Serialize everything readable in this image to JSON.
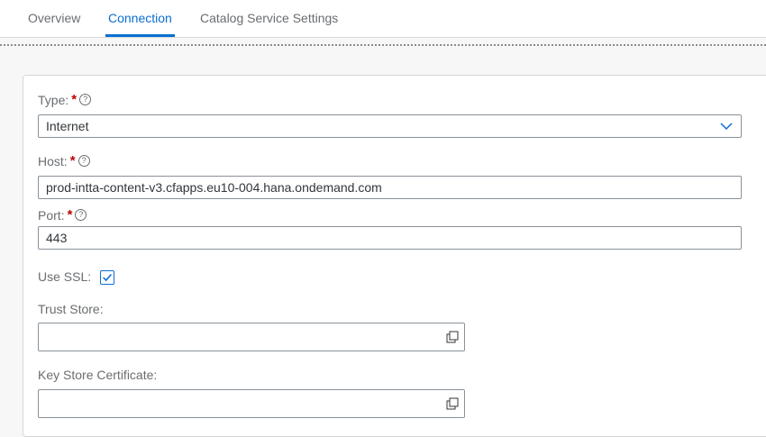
{
  "tabs": [
    {
      "label": "Overview",
      "active": false
    },
    {
      "label": "Connection",
      "active": true
    },
    {
      "label": "Catalog Service Settings",
      "active": false
    }
  ],
  "form": {
    "type": {
      "label": "Type:",
      "required": true,
      "value": "Internet"
    },
    "host": {
      "label": "Host:",
      "required": true,
      "value": "prod-intta-content-v3.cfapps.eu10-004.hana.ondemand.com"
    },
    "port": {
      "label": "Port:",
      "required": true,
      "value": "443"
    },
    "use_ssl": {
      "label": "Use SSL:",
      "checked": true
    },
    "trust_store": {
      "label": "Trust Store:",
      "value": ""
    },
    "key_store_certificate": {
      "label": "Key Store Certificate:",
      "value": ""
    }
  },
  "symbols": {
    "required": "*",
    "help": "?"
  },
  "colors": {
    "accent": "#0a6ed1",
    "required": "#bb0000",
    "border": "#89919a",
    "background": "#f7f7f7"
  }
}
